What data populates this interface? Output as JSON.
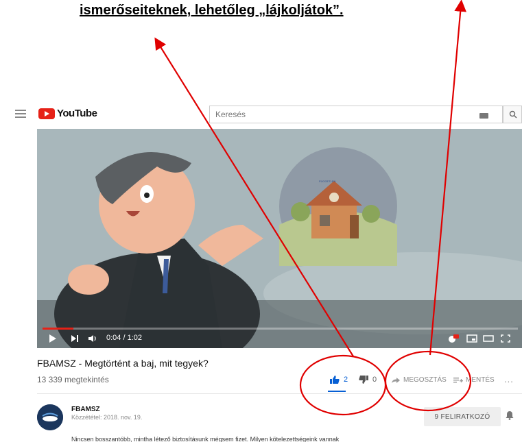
{
  "instruction_text": "ismerőseiteknek, lehetőleg „lájkoljátok”.",
  "topbar": {
    "logo_text": "YouTube",
    "search_placeholder": "Keresés"
  },
  "player": {
    "time_display": "0:04 / 1:02",
    "progress_fraction": 0.065
  },
  "video": {
    "title": "FBAMSZ - Megtörtént a baj, mit tegyek?",
    "views": "13 339 megtekintés",
    "like_count": "2",
    "dislike_count": "0",
    "share_label": "MEGOSZTÁS",
    "save_label": "MENTÉS",
    "more_label": "..."
  },
  "channel": {
    "name": "FBAMSZ",
    "published": "Közzététel: 2018. nov. 19.",
    "subscribe_label": "9 FELIRATKOZÓ"
  },
  "description": "Nincsen bosszantóbb, mintha létező biztosításunk mégsem fizet. Milyen kötelezettségeink vannak",
  "colors": {
    "brand_red": "#e62117",
    "like_blue": "#065fd4",
    "annotation_red": "#e00000"
  },
  "icons": [
    "menu-icon",
    "youtube-play-icon",
    "keyboard-icon",
    "search-icon",
    "play-icon",
    "next-icon",
    "volume-icon",
    "autoplay-icon",
    "miniplayer-icon",
    "theater-icon",
    "fullscreen-icon",
    "thumbs-up-icon",
    "thumbs-down-icon",
    "share-icon",
    "add-to-playlist-icon",
    "bell-icon"
  ]
}
